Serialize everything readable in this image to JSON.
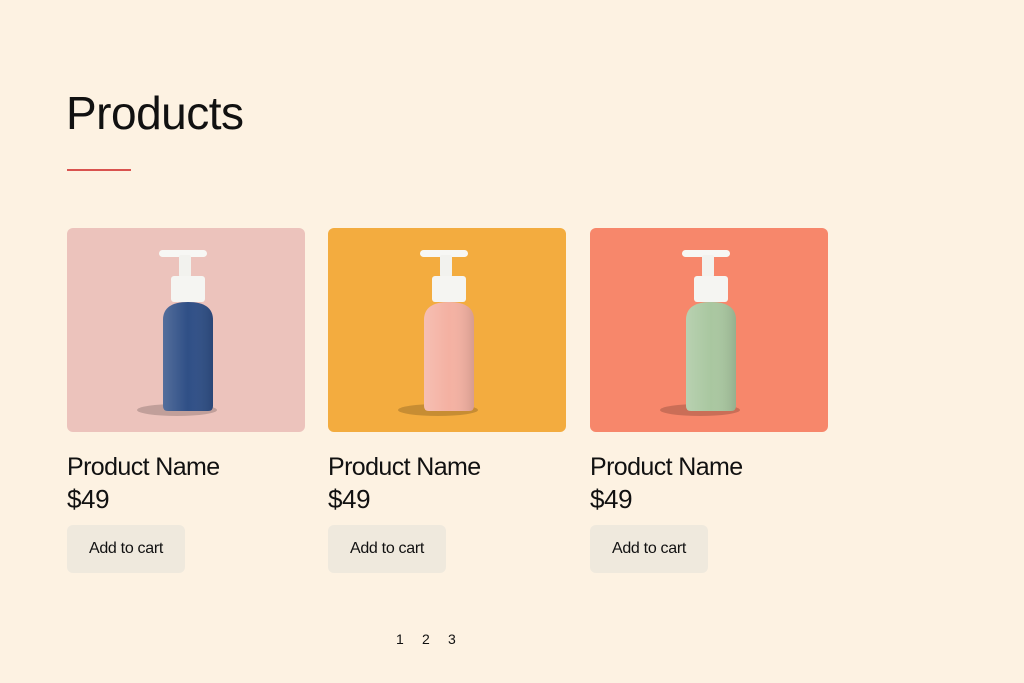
{
  "header": {
    "title": "Products"
  },
  "colors": {
    "background": "#fdf2e2",
    "accent": "#d9534f",
    "button_bg": "#efe9dd"
  },
  "products": [
    {
      "name": "Product Name",
      "price": "$49",
      "button_label": "Add to cart",
      "image": "blue-pump-bottle-on-pink",
      "image_bg": "#ecc3bc",
      "bottle_color": "#2f4f86"
    },
    {
      "name": "Product Name",
      "price": "$49",
      "button_label": "Add to cart",
      "image": "pink-pump-bottle-on-orange",
      "image_bg": "#f3ac3f",
      "bottle_color": "#f4b1a2"
    },
    {
      "name": "Product Name",
      "price": "$49",
      "button_label": "Add to cart",
      "image": "green-pump-bottle-on-coral",
      "image_bg": "#f7876b",
      "bottle_color": "#a9c7a0"
    }
  ],
  "pagination": {
    "pages": [
      "1",
      "2",
      "3"
    ]
  }
}
